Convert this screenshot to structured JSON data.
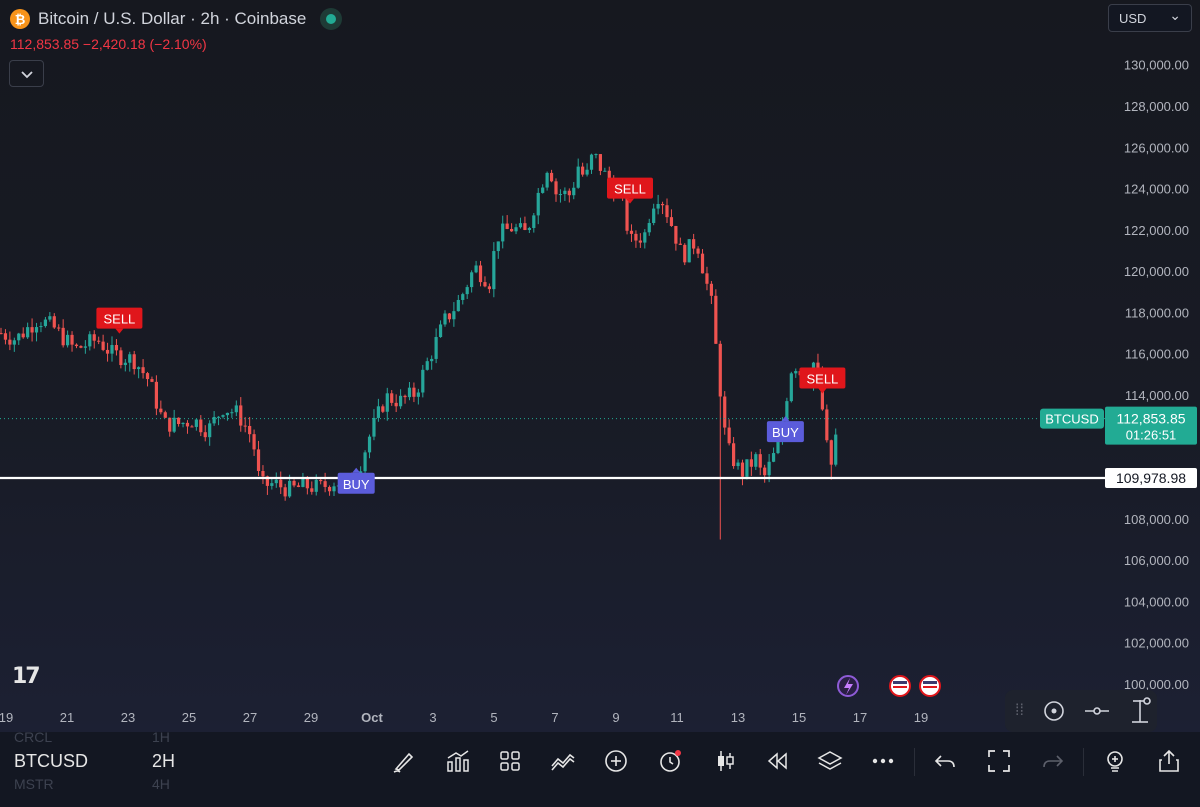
{
  "header": {
    "title": "Bitcoin / U.S. Dollar · 2h · Coinbase",
    "btc_symbol": "₿",
    "price_change": "112,853.85  −2,420.18 (−2.10%)",
    "collapse_icon": "chevron-down-icon"
  },
  "currency": {
    "label": "USD",
    "chevron": "⌄"
  },
  "colors": {
    "up": "#26a69a",
    "down": "#ef5350",
    "sell": "#e0161b",
    "buy": "#5b5cdb",
    "current": "#22ab94"
  },
  "chart_data": {
    "type": "candlestick",
    "ylim": [
      99000,
      131500
    ],
    "y_ticks": [
      "100,000.00",
      "102,000.00",
      "104,000.00",
      "106,000.00",
      "108,000.00",
      "110,000.00",
      "112,000.00",
      "114,000.00",
      "116,000.00",
      "118,000.00",
      "120,000.00",
      "122,000.00",
      "124,000.00",
      "126,000.00",
      "128,000.00",
      "130,000.00"
    ],
    "x_ticks": [
      "17",
      "19",
      "21",
      "23",
      "25",
      "27",
      "29",
      "Oct",
      "3",
      "5",
      "7",
      "9",
      "11",
      "13",
      "15",
      "17",
      "19"
    ],
    "price_path": [
      [
        0,
        117000
      ],
      [
        2,
        116700
      ],
      [
        5,
        117700
      ],
      [
        7,
        117300
      ],
      [
        10,
        116200
      ],
      [
        13,
        116700
      ],
      [
        15,
        116000
      ],
      [
        18,
        115700
      ],
      [
        20,
        114700
      ],
      [
        22,
        112600
      ],
      [
        24,
        112600
      ],
      [
        26,
        112800
      ],
      [
        28,
        112300
      ],
      [
        30,
        113400
      ],
      [
        32,
        113100
      ],
      [
        34,
        111900
      ],
      [
        35,
        109600
      ],
      [
        37,
        109700
      ],
      [
        39,
        109400
      ],
      [
        41,
        109600
      ],
      [
        43,
        109500
      ],
      [
        45,
        109800
      ],
      [
        47,
        109700
      ],
      [
        48,
        110100
      ],
      [
        50,
        112200
      ],
      [
        52,
        113900
      ],
      [
        54,
        113700
      ],
      [
        56,
        114100
      ],
      [
        58,
        115900
      ],
      [
        60,
        117600
      ],
      [
        62,
        118600
      ],
      [
        64,
        120200
      ],
      [
        66,
        119500
      ],
      [
        67,
        121700
      ],
      [
        69,
        122100
      ],
      [
        71,
        121800
      ],
      [
        72,
        123100
      ],
      [
        74,
        125300
      ],
      [
        75,
        123800
      ],
      [
        77,
        123700
      ],
      [
        78,
        125100
      ],
      [
        79,
        124400
      ],
      [
        80,
        125700
      ],
      [
        82,
        124400
      ],
      [
        84,
        123400
      ],
      [
        85,
        121400
      ],
      [
        87,
        121800
      ],
      [
        88,
        123300
      ],
      [
        89,
        123800
      ],
      [
        91,
        121900
      ],
      [
        92,
        120700
      ],
      [
        94,
        121500
      ],
      [
        96,
        118400
      ],
      [
        98,
        111500
      ],
      [
        100,
        110200
      ],
      [
        102,
        110900
      ],
      [
        103,
        109900
      ],
      [
        105,
        111500
      ],
      [
        107,
        115700
      ],
      [
        108,
        115100
      ],
      [
        109,
        114600
      ],
      [
        110,
        115800
      ],
      [
        111,
        113300
      ],
      [
        112,
        110200
      ],
      [
        113,
        112400
      ]
    ],
    "special_wicks": [
      {
        "t": 97,
        "low": 107000
      },
      {
        "t": 112,
        "low": 109900
      }
    ],
    "current_price": {
      "label": "BTCUSD",
      "value": "112,853.85",
      "countdown": "01:26:51",
      "y": 112853.85
    },
    "level_line": {
      "value": "109,978.98",
      "y": 109978.98
    },
    "signals": [
      {
        "label": "SELL",
        "t": 16,
        "price": 117700,
        "side": "sell"
      },
      {
        "label": "BUY",
        "t": 48,
        "price": 109700,
        "side": "buy"
      },
      {
        "label": "SELL",
        "t": 85,
        "price": 124000,
        "side": "sell"
      },
      {
        "label": "BUY",
        "t": 106,
        "price": 112200,
        "side": "buy"
      },
      {
        "label": "SELL",
        "t": 111,
        "price": 114800,
        "side": "sell"
      }
    ]
  },
  "watermark": "17",
  "draw_tools": [
    "dots-grip-icon",
    "circle-tool-icon",
    "line-tool-icon",
    "measure-tool-icon"
  ],
  "bottom": {
    "symbol_prev": "CRCL",
    "symbol": "BTCUSD",
    "symbol_next": "MSTR",
    "interval_prev": "1H",
    "interval": "2H",
    "interval_next": "4H"
  }
}
